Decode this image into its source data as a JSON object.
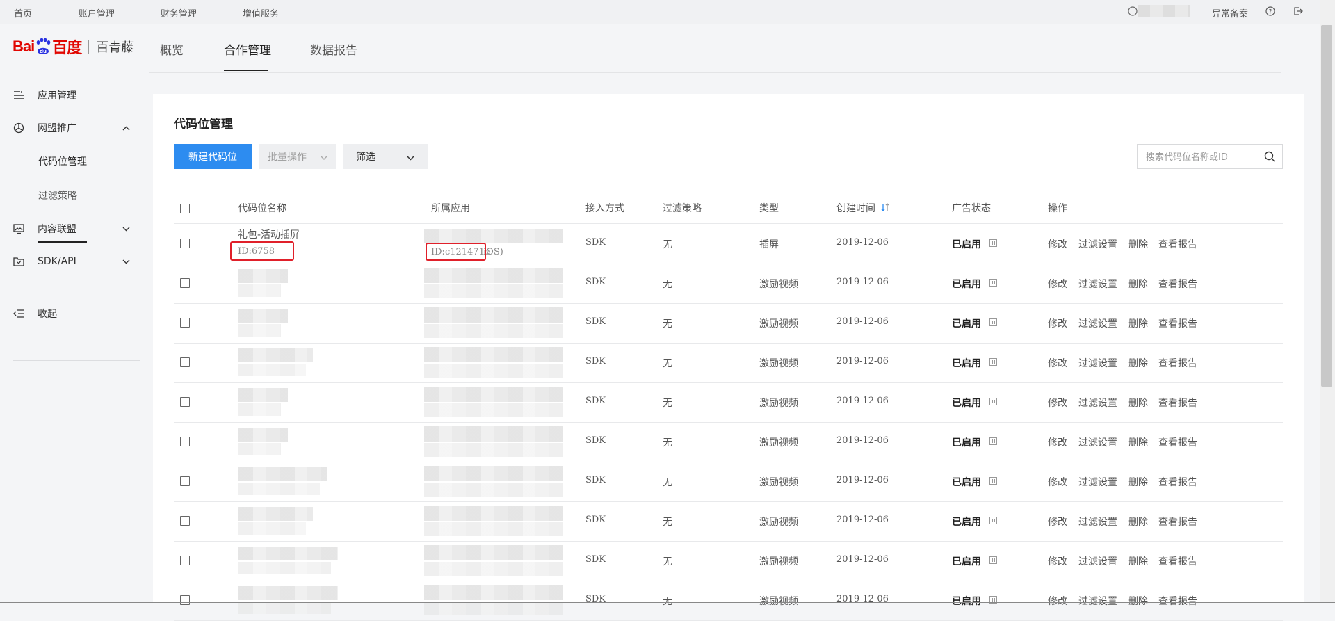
{
  "topbar": {
    "nav": [
      "首页",
      "账户管理",
      "财务管理",
      "增值服务"
    ],
    "right_link": "异常备案"
  },
  "brand": {
    "baidu": "Bai",
    "baidu2": "百度",
    "product": "百青藤"
  },
  "main_nav": [
    "概览",
    "合作管理",
    "数据报告"
  ],
  "sidebar": {
    "items": [
      {
        "label": "应用管理",
        "icon": "list-icon"
      },
      {
        "label": "网盟推广",
        "icon": "network-icon"
      },
      {
        "label": "内容联盟",
        "icon": "image-icon"
      },
      {
        "label": "SDK/API",
        "icon": "sdk-icon"
      }
    ],
    "sub_items": [
      "代码位管理",
      "过滤策略"
    ],
    "collapse": "收起"
  },
  "page": {
    "title": "代码位管理",
    "new_button": "新建代码位",
    "batch_button": "批量操作",
    "filter_button": "筛选",
    "search_placeholder": "搜索代码位名称或ID"
  },
  "table": {
    "columns": [
      "代码位名称",
      "所属应用",
      "接入方式",
      "过滤策略",
      "类型",
      "创建时间",
      "广告状态",
      "操作"
    ],
    "operations": [
      "修改",
      "过滤设置",
      "删除",
      "查看报告"
    ],
    "rows": [
      {
        "name": "礼包-活动插屏",
        "id": "ID:6758",
        "app_id": "ID:c121471e",
        "app_os": "iOS)",
        "access": "SDK",
        "filter": "无",
        "type": "插屏",
        "date": "2019-12-06",
        "status": "已启用"
      },
      {
        "access": "SDK",
        "filter": "无",
        "type": "激励视频",
        "date": "2019-12-06",
        "status": "已启用"
      },
      {
        "access": "SDK",
        "filter": "无",
        "type": "激励视频",
        "date": "2019-12-06",
        "status": "已启用"
      },
      {
        "access": "SDK",
        "filter": "无",
        "type": "激励视频",
        "date": "2019-12-06",
        "status": "已启用"
      },
      {
        "access": "SDK",
        "filter": "无",
        "type": "激励视频",
        "date": "2019-12-06",
        "status": "已启用"
      },
      {
        "access": "SDK",
        "filter": "无",
        "type": "激励视频",
        "date": "2019-12-06",
        "status": "已启用"
      },
      {
        "access": "SDK",
        "filter": "无",
        "type": "激励视频",
        "date": "2019-12-06",
        "status": "已启用"
      },
      {
        "access": "SDK",
        "filter": "无",
        "type": "激励视频",
        "date": "2019-12-06",
        "status": "已启用"
      },
      {
        "access": "SDK",
        "filter": "无",
        "type": "激励视频",
        "date": "2019-12-06",
        "status": "已启用"
      },
      {
        "access": "SDK",
        "filter": "无",
        "type": "激励视频",
        "date": "2019-12-06",
        "status": "已启用"
      }
    ]
  },
  "colors": {
    "primary": "#2d8cf0",
    "brand_red": "#e10601",
    "highlight_box": "#e0202a"
  }
}
